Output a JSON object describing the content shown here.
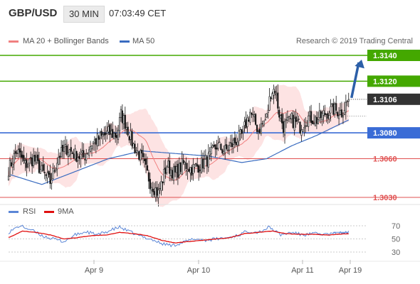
{
  "header": {
    "symbol": "GBP/USD",
    "timeframe": "30 MIN",
    "time": "07:03:49 CET"
  },
  "legend": {
    "ma20_label": "MA 20 + Bollinger Bands",
    "ma50_label": "MA 50",
    "credit": "Research © 2019 Trading Central",
    "rsi_label": "RSI",
    "rsi_ma_label": "9MA"
  },
  "colors": {
    "ma20": "#f08080",
    "bands_fill": "#fde0e0",
    "ma50": "#3a6cc0",
    "level_green": "#44a800",
    "level_red": "#e05050",
    "level_blue": "#3a6cd6",
    "current": "#333333",
    "candle": "#1a1a1a",
    "arrow": "#2c5fa8",
    "rsi": "#5b86d6",
    "rsi_ma": "#e01010"
  },
  "chart_data": [
    {
      "type": "candlestick",
      "ylim": [
        1.302,
        1.315
      ],
      "x_ticks": [
        "Apr 9",
        "Apr 10",
        "Apr 11",
        "Apr 19"
      ],
      "y_labels": [
        {
          "value": 1.314,
          "text": "1.3140",
          "style": "green-box"
        },
        {
          "value": 1.312,
          "text": "1.3120",
          "style": "green-box"
        },
        {
          "value": 1.3106,
          "text": "1.3106",
          "style": "dark-box"
        },
        {
          "value": 1.308,
          "text": "1.3080",
          "style": "blue-box"
        },
        {
          "value": 1.306,
          "text": "1.3060",
          "style": "red-text"
        },
        {
          "value": 1.303,
          "text": "1.3030",
          "style": "red-text"
        }
      ],
      "levels": [
        {
          "value": 1.314,
          "kind": "resistance"
        },
        {
          "value": 1.312,
          "kind": "resistance"
        },
        {
          "value": 1.308,
          "kind": "pivot"
        },
        {
          "value": 1.306,
          "kind": "support"
        },
        {
          "value": 1.303,
          "kind": "support"
        }
      ],
      "current_price": 1.3106,
      "close_anchors": [
        [
          0,
          1.3052
        ],
        [
          6,
          1.3066
        ],
        [
          12,
          1.3055
        ],
        [
          18,
          1.306
        ],
        [
          24,
          1.305
        ],
        [
          30,
          1.3042
        ],
        [
          36,
          1.3062
        ],
        [
          42,
          1.3068
        ],
        [
          48,
          1.3063
        ],
        [
          54,
          1.3061
        ],
        [
          60,
          1.3072
        ],
        [
          66,
          1.3076
        ],
        [
          72,
          1.308
        ],
        [
          78,
          1.3078
        ],
        [
          81,
          1.3094
        ],
        [
          84,
          1.3088
        ],
        [
          90,
          1.307
        ],
        [
          96,
          1.306
        ],
        [
          102,
          1.3042
        ],
        [
          108,
          1.3033
        ],
        [
          114,
          1.3055
        ],
        [
          120,
          1.3048
        ],
        [
          126,
          1.3056
        ],
        [
          132,
          1.3052
        ],
        [
          138,
          1.3055
        ],
        [
          144,
          1.306
        ],
        [
          150,
          1.307
        ],
        [
          156,
          1.3066
        ],
        [
          162,
          1.3072
        ],
        [
          168,
          1.3078
        ],
        [
          174,
          1.3096
        ],
        [
          180,
          1.3082
        ],
        [
          186,
          1.3092
        ],
        [
          189,
          1.3112
        ],
        [
          192,
          1.3114
        ],
        [
          195,
          1.3095
        ],
        [
          198,
          1.3085
        ],
        [
          204,
          1.309
        ],
        [
          210,
          1.3085
        ],
        [
          216,
          1.3092
        ],
        [
          222,
          1.309
        ],
        [
          228,
          1.3095
        ],
        [
          234,
          1.3098
        ],
        [
          240,
          1.3096
        ],
        [
          245,
          1.3106
        ]
      ],
      "ma50_anchors": [
        [
          0,
          1.3048
        ],
        [
          24,
          1.304
        ],
        [
          48,
          1.305
        ],
        [
          72,
          1.306
        ],
        [
          96,
          1.3066
        ],
        [
          120,
          1.3064
        ],
        [
          144,
          1.3062
        ],
        [
          168,
          1.3057
        ],
        [
          186,
          1.306
        ],
        [
          204,
          1.307
        ],
        [
          222,
          1.3078
        ],
        [
          245,
          1.309
        ]
      ],
      "annotation": "arrow up from 1.3106 toward 1.3140"
    },
    {
      "type": "line",
      "series": [
        {
          "name": "RSI",
          "anchors": [
            [
              0,
              60
            ],
            [
              8,
              70
            ],
            [
              16,
              64
            ],
            [
              24,
              55
            ],
            [
              32,
              50
            ],
            [
              40,
              46
            ],
            [
              48,
              56
            ],
            [
              56,
              61
            ],
            [
              64,
              56
            ],
            [
              72,
              62
            ],
            [
              80,
              68
            ],
            [
              86,
              62
            ],
            [
              94,
              55
            ],
            [
              102,
              50
            ],
            [
              110,
              43
            ],
            [
              118,
              40
            ],
            [
              126,
              45
            ],
            [
              134,
              50
            ],
            [
              142,
              48
            ],
            [
              150,
              50
            ],
            [
              158,
              52
            ],
            [
              166,
              56
            ],
            [
              172,
              62
            ],
            [
              180,
              60
            ],
            [
              188,
              68
            ],
            [
              196,
              56
            ],
            [
              204,
              60
            ],
            [
              212,
              56
            ],
            [
              220,
              58
            ],
            [
              230,
              57
            ],
            [
              245,
              60
            ]
          ]
        },
        {
          "name": "9MA",
          "anchors": [
            [
              0,
              52
            ],
            [
              10,
              62
            ],
            [
              20,
              60
            ],
            [
              30,
              56
            ],
            [
              40,
              50
            ],
            [
              50,
              52
            ],
            [
              60,
              55
            ],
            [
              70,
              56
            ],
            [
              80,
              60
            ],
            [
              90,
              58
            ],
            [
              100,
              55
            ],
            [
              110,
              48
            ],
            [
              120,
              44
            ],
            [
              130,
              46
            ],
            [
              140,
              48
            ],
            [
              150,
              50
            ],
            [
              160,
              52
            ],
            [
              170,
              58
            ],
            [
              180,
              60
            ],
            [
              190,
              62
            ],
            [
              200,
              58
            ],
            [
              210,
              57
            ],
            [
              220,
              57
            ],
            [
              230,
              56
            ],
            [
              245,
              58
            ]
          ]
        }
      ],
      "ylim": [
        20,
        80
      ],
      "y_ticks": [
        70,
        50,
        30
      ]
    }
  ]
}
